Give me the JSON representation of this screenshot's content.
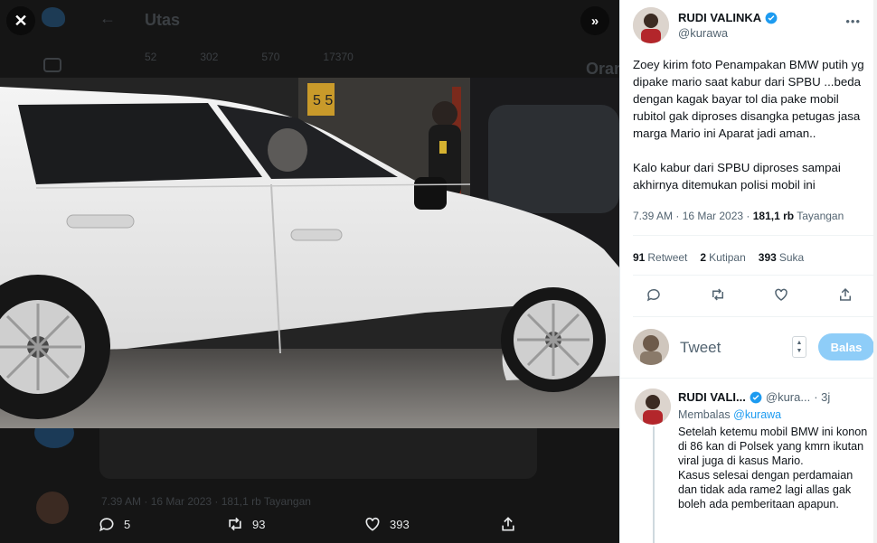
{
  "viewer": {
    "close_icon": "close-icon",
    "expand_icon": "expand-icon",
    "background": {
      "title": "Utas",
      "right_title": "Orang",
      "meta": "7.39 AM · 16 Mar 2023 · 181,1 rb Tayangan",
      "stats": [
        "52",
        "302",
        "570",
        "17370"
      ]
    },
    "actions": {
      "reply_count": "5",
      "retweet_count": "93",
      "like_count": "393"
    }
  },
  "tweet": {
    "author_name": "RUDI VALINKA",
    "author_handle": "@kurawa",
    "text_paragraphs": [
      "Zoey kirim foto Penampakan BMW putih yg dipake mario saat kabur dari SPBU ...beda dengan kagak bayar tol dia pake mobil rubitol gak diproses disangka petugas jasa marga Mario ini Aparat jadi aman..",
      "Kalo kabur dari SPBU diproses sampai akhirnya ditemukan polisi mobil ini"
    ],
    "time": "7.39 AM · 16 Mar 2023 · ",
    "views": "181,1 rb",
    "views_label": " Tayangan",
    "stats": {
      "retweets": "91",
      "retweets_label": "Retweet",
      "quotes": "2",
      "quotes_label": "Kutipan",
      "likes": "393",
      "likes_label": "Suka"
    }
  },
  "reply_composer": {
    "placeholder": "Tweet",
    "button_label": "Balas"
  },
  "reply": {
    "author_name": "RUDI VALI...",
    "author_handle": "@kura...",
    "time": "· 3j",
    "replying_prefix": "Membalas ",
    "replying_handle": "@kurawa",
    "text_paragraphs": [
      "Setelah ketemu mobil BMW ini konon di 86 kan di Polsek yang kmrn ikutan viral juga di kasus Mario.",
      "Kasus selesai dengan perdamaian dan tidak ada rame2 lagi allas gak boleh ada pemberitaan apapun."
    ]
  },
  "colors": {
    "accent": "#1d9bf0",
    "reply_button": "#8ecdf8",
    "viewer_bg": "#151515"
  }
}
